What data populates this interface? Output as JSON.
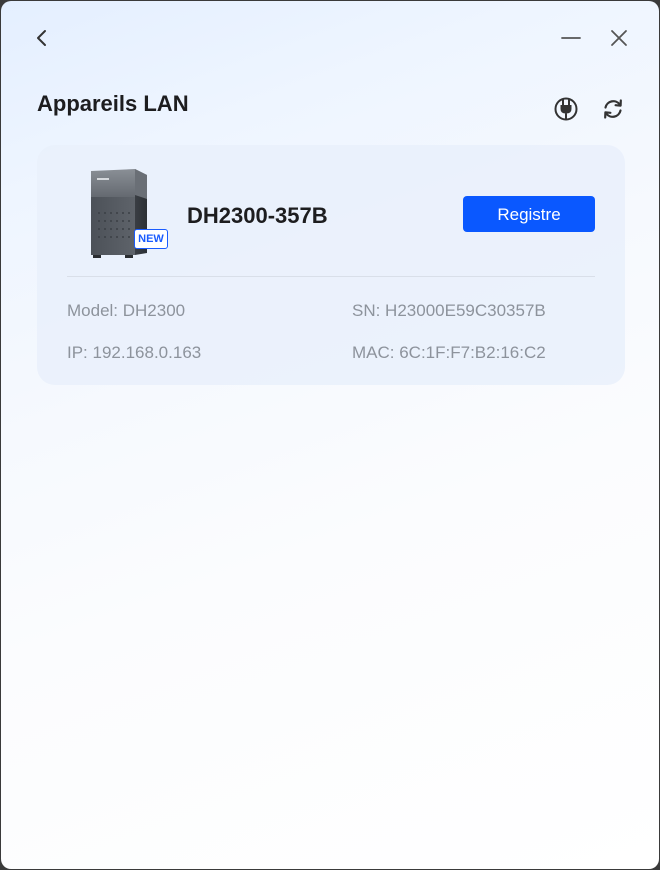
{
  "header": {
    "title": "Appareils LAN"
  },
  "icons": {
    "back": "chevron-left-icon",
    "minimize": "minimize-icon",
    "close": "close-icon",
    "power": "plug-icon",
    "refresh": "refresh-icon"
  },
  "device": {
    "badge": "NEW",
    "name": "DH2300-357B",
    "register_label": "Registre",
    "model": "Model: DH2300",
    "sn": "SN: H23000E59C30357B",
    "ip": "IP: 192.168.0.163",
    "mac": "MAC: 6C:1F:F7:B2:16:C2"
  },
  "colors": {
    "accent": "#0a58ff",
    "badge": "#1a5cff"
  }
}
